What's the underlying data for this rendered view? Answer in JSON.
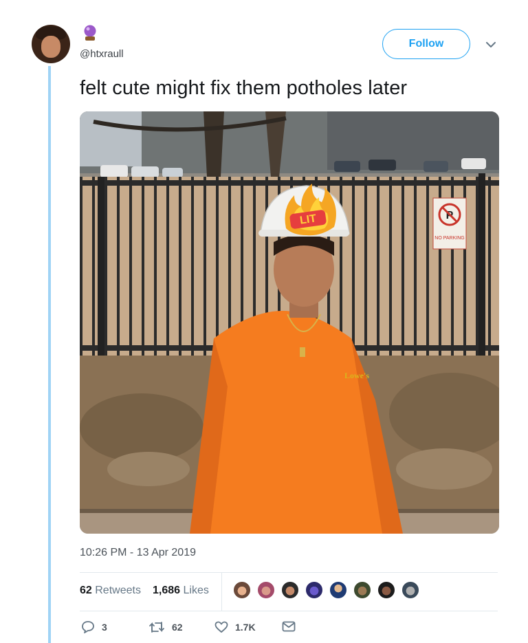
{
  "author": {
    "handle": "@htxraull",
    "avatar_icon": "profile-photo",
    "badge_icon": "crystal-ball-emoji"
  },
  "follow_label": "Follow",
  "tweet": {
    "text": "felt cute might fix them potholes later",
    "timestamp": "10:26 PM - 13 Apr 2019"
  },
  "photo": {
    "helmet_sticker_text": "LIT",
    "sign_text": "NO PARKING",
    "shirt_logo": "Lowe's Company"
  },
  "stats": {
    "retweets_count": "62",
    "retweets_label": "Retweets",
    "likes_count": "1,686",
    "likes_label": "Likes",
    "liker_count": 8
  },
  "actions": {
    "replies": "3",
    "retweets": "62",
    "likes": "1.7K"
  },
  "colors": {
    "accent": "#1da1f2",
    "thread_line": "#9fd3f5",
    "shirt": "#f57c1f"
  }
}
